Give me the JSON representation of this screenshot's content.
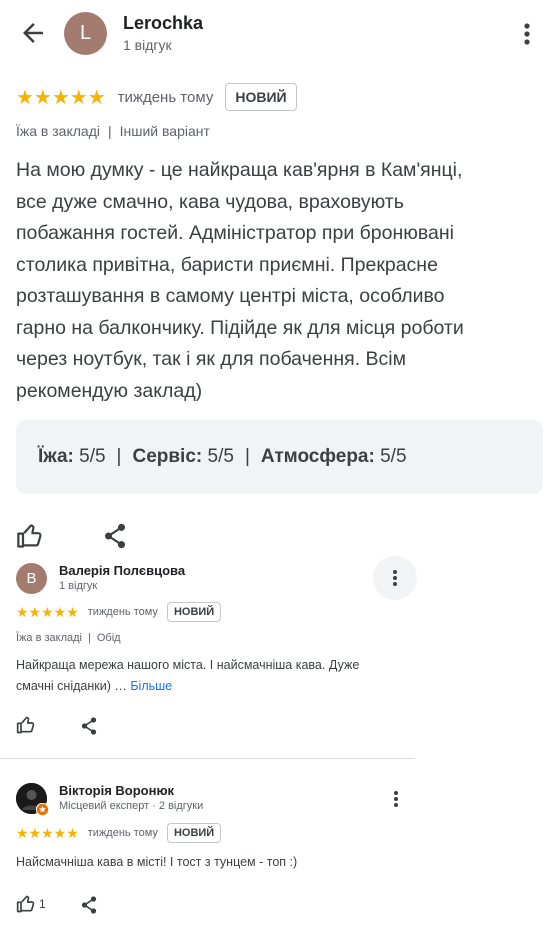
{
  "top_review": {
    "author_initial": "L",
    "author": "Lerochka",
    "review_count": "1 відгук",
    "stars": "★★★★★",
    "time": "тиждень тому",
    "badge": "НОВИЙ",
    "meta_1": "Їжа в закладі",
    "meta_sep": "|",
    "meta_2": "Інший варіант",
    "text_lines": [
      "На мою думку - це найкраща кав'ярня в Кам'янці,",
      "все дуже смачно, кава чудова, враховують",
      "побажання гостей. Адміністратор при бронювані",
      "столика привітна, баристи приємні. Прекрасне",
      "розташування в самому центрі міста, особливо",
      "гарно на балкончику. Підійде як для місця роботи",
      "через ноутбук, так і як для побачення. Всім",
      "рекомендую заклад)"
    ],
    "scores": {
      "food_label": "Їжа:",
      "food_value": "5/5",
      "service_label": "Сервіс:",
      "service_value": "5/5",
      "atmosphere_label": "Атмосфера:",
      "atmosphere_value": "5/5",
      "sep": "|"
    }
  },
  "review_2": {
    "author_initial": "В",
    "author": "Валерія Полєвцова",
    "review_count": "1 відгук",
    "stars": "★★★★★",
    "time": "тиждень тому",
    "badge": "НОВИЙ",
    "meta_1": "Їжа в закладі",
    "meta_sep": "|",
    "meta_2": "Обід",
    "text_line_1": "Найкраща мережа нашого міста. І найсмачніша кава. Дуже",
    "text_line_2": "смачні сніданки) …",
    "more_label": "Більше"
  },
  "review_3": {
    "author": "Вікторія Воронюк",
    "review_count": "Місцевий експерт · 2 відгуки",
    "stars": "★★★★★",
    "time": "тиждень тому",
    "badge": "НОВИЙ",
    "text": "Найсмачніша кава в місті! І тост з тунцем - топ :)",
    "like_count": "1"
  },
  "icons": {
    "back": "arrow-left-icon",
    "more": "more-vert-icon",
    "like": "thumb-up-icon",
    "share": "share-icon",
    "expert": "local-guide-badge-icon"
  },
  "colors": {
    "star": "#f4b400",
    "link": "#1a73e8",
    "avatar": "#a47c6f",
    "score_panel": "#f1f3f4"
  }
}
